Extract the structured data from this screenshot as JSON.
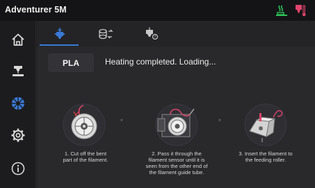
{
  "app": {
    "title": "Adventurer 5M"
  },
  "status_icons": {
    "bed": "bed-heating-icon",
    "nozzle": "nozzle-heating-icon",
    "bed_color": "#2ec45a",
    "nozzle_color": "#e0446d"
  },
  "sidebar": {
    "items": [
      {
        "name": "home-icon",
        "active": false
      },
      {
        "name": "printer-icon",
        "active": false
      },
      {
        "name": "filament-icon",
        "active": true
      },
      {
        "name": "settings-gear-icon",
        "active": false
      },
      {
        "name": "info-icon",
        "active": false
      }
    ]
  },
  "tabs": [
    {
      "name": "load-filament-icon",
      "active": true
    },
    {
      "name": "filament-spool-switch-icon",
      "active": false
    },
    {
      "name": "unload-filament-icon",
      "active": false
    }
  ],
  "material": {
    "label": "PLA"
  },
  "status": {
    "message": "Heating completed. Loading..."
  },
  "steps": [
    {
      "text_lines": [
        "1. Cut off the bent",
        "part of the filament."
      ]
    },
    {
      "text_lines": [
        "2. Pass it through the",
        "filament sensor until it is",
        "seen from the other end of",
        "the filament guide tube."
      ]
    },
    {
      "text_lines": [
        "3. Insert the filament to",
        "the feeding roller."
      ]
    }
  ],
  "arrows": [
    "›› ",
    "›› "
  ],
  "colors": {
    "accent": "#3a7ad6",
    "filament": "#e0446d"
  }
}
